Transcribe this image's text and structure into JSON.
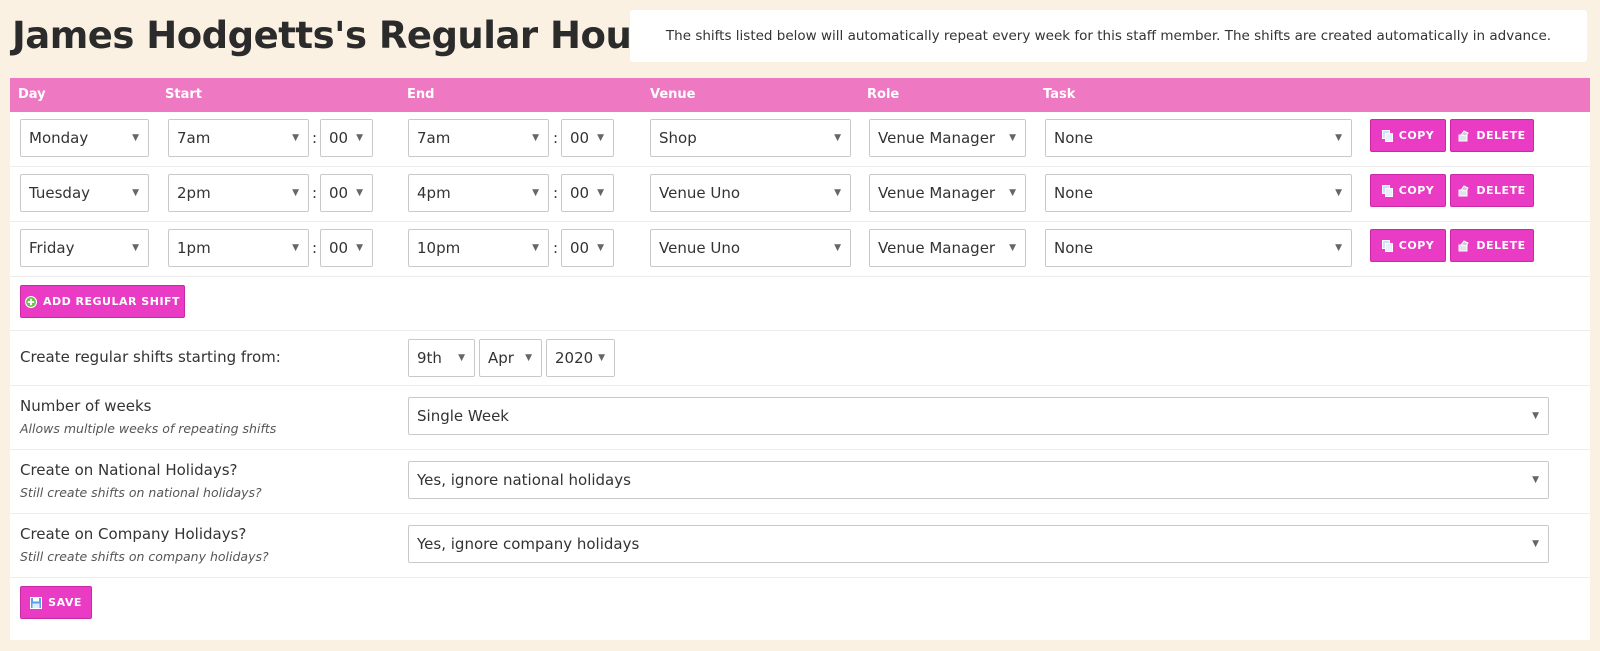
{
  "page": {
    "title": "James Hodgetts's Regular Hours",
    "info": "The shifts listed below will automatically repeat every week for this staff member. The shifts are created automatically in advance."
  },
  "table": {
    "headers": {
      "day": "Day",
      "start": "Start",
      "end": "End",
      "venue": "Venue",
      "role": "Role",
      "task": "Task"
    },
    "rows": [
      {
        "day": "Monday",
        "start_hour": "7am",
        "start_min": "00",
        "end_hour": "7am",
        "end_min": "00",
        "venue": "Shop",
        "role": "Venue Manager",
        "task": "None"
      },
      {
        "day": "Tuesday",
        "start_hour": "2pm",
        "start_min": "00",
        "end_hour": "4pm",
        "end_min": "00",
        "venue": "Venue Uno",
        "role": "Venue Manager",
        "task": "None"
      },
      {
        "day": "Friday",
        "start_hour": "1pm",
        "start_min": "00",
        "end_hour": "10pm",
        "end_min": "00",
        "venue": "Venue Uno",
        "role": "Venue Manager",
        "task": "None"
      }
    ],
    "time_separator": ":",
    "copy_label": "COPY",
    "delete_label": "DELETE",
    "add_label": "ADD REGULAR SHIFT"
  },
  "settings": {
    "start_from": {
      "label": "Create regular shifts starting from:",
      "day": "9th",
      "month": "Apr",
      "year": "2020"
    },
    "weeks": {
      "label": "Number of weeks",
      "hint": "Allows multiple weeks of repeating shifts",
      "value": "Single Week"
    },
    "national": {
      "label": "Create on National Holidays?",
      "hint": "Still create shifts on national holidays?",
      "value": "Yes, ignore national holidays"
    },
    "company": {
      "label": "Create on Company Holidays?",
      "hint": "Still create shifts on company holidays?",
      "value": "Yes, ignore company holidays"
    },
    "save_label": "SAVE"
  },
  "icons": {
    "caret": "▼",
    "copy": "copy-icon",
    "delete": "delete-icon",
    "add": "plus-circle-icon",
    "save": "floppy-disk-icon"
  },
  "colors": {
    "header_bg": "#ef78c2",
    "button_bg": "#e93bc4",
    "page_bg": "#fbf1e3"
  }
}
